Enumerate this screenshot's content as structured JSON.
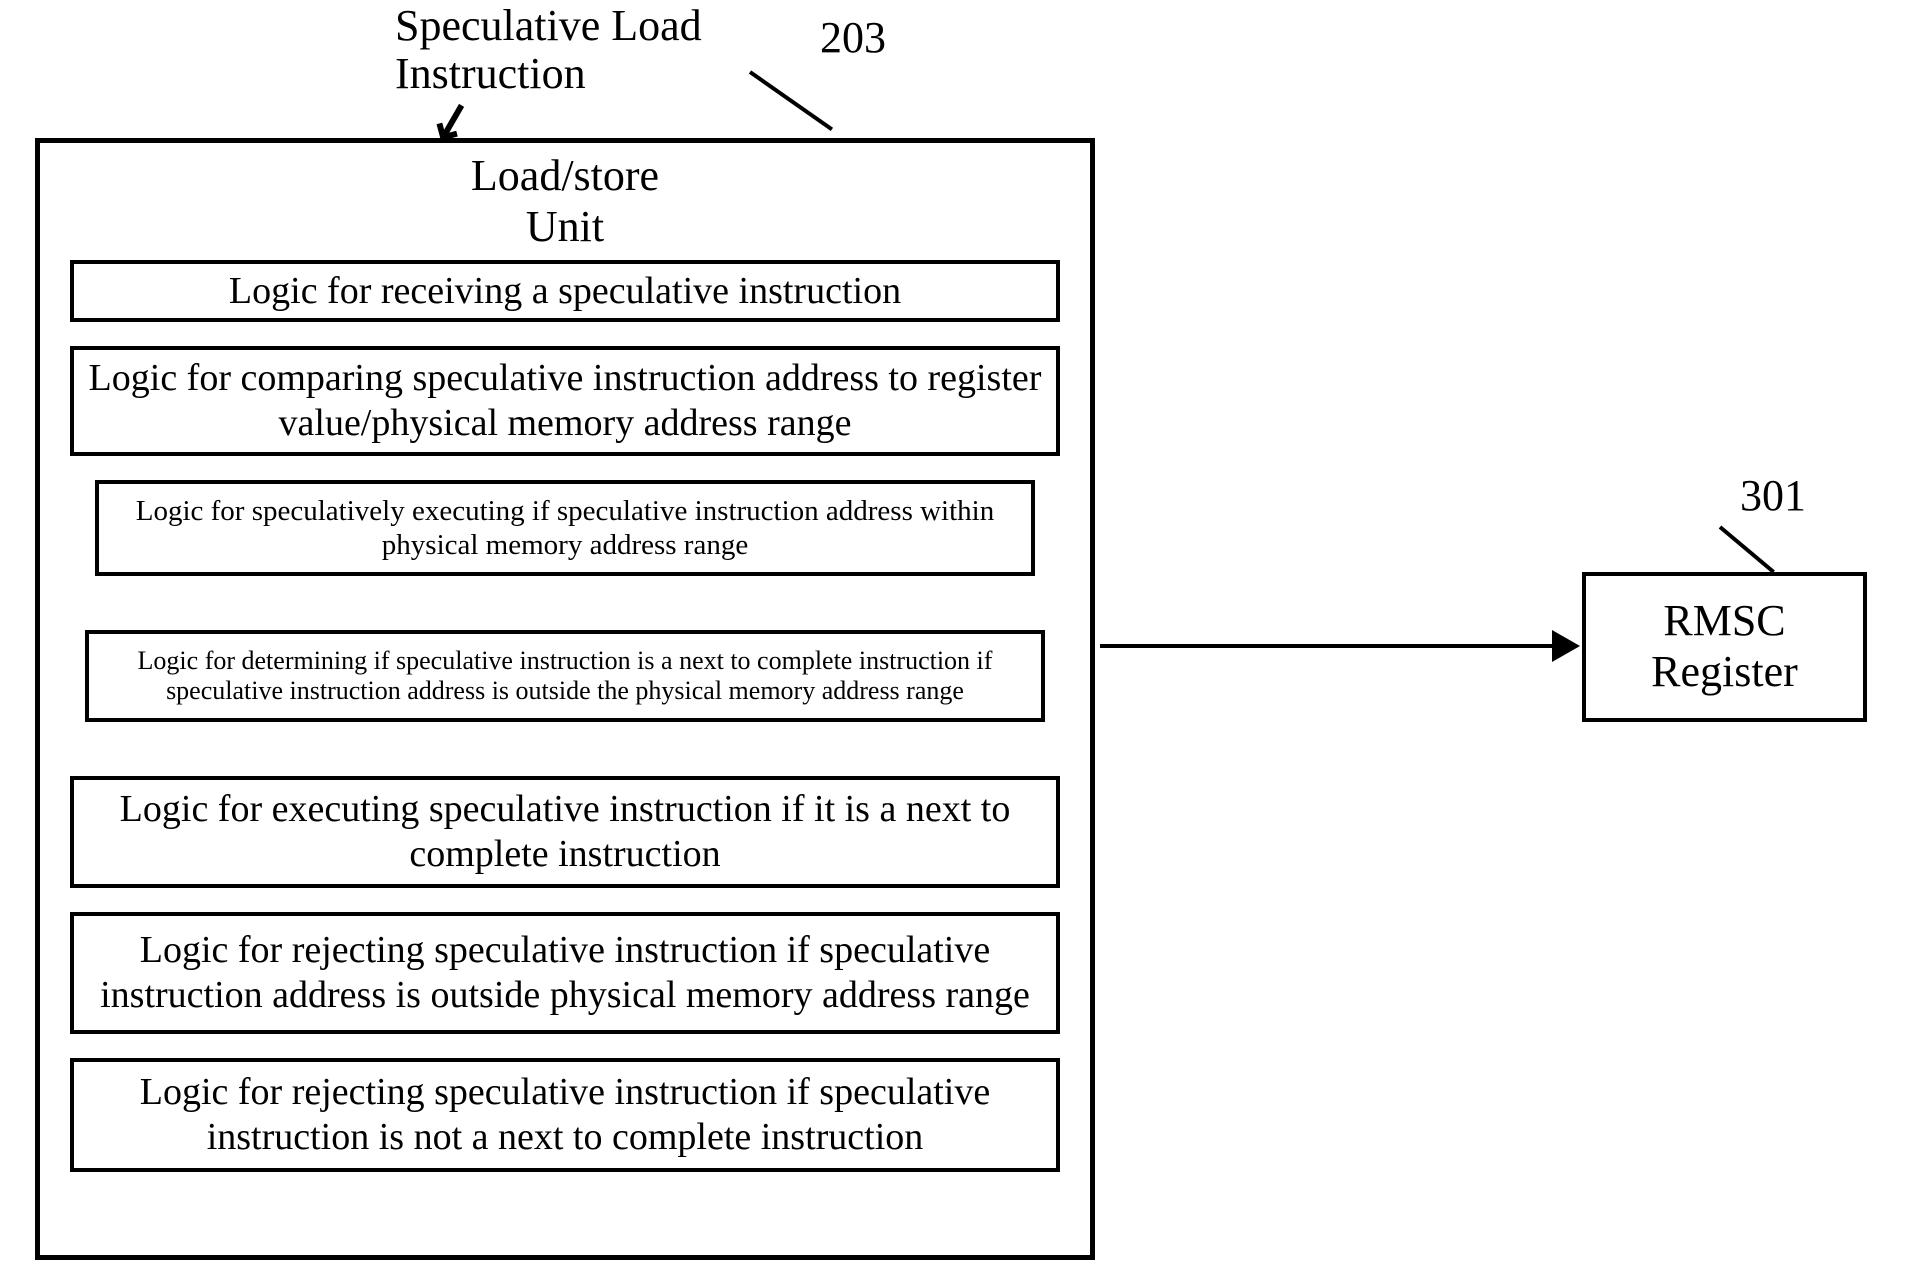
{
  "input": {
    "label": "Speculative Load\nInstruction"
  },
  "refs": {
    "main": "203",
    "register": "301"
  },
  "main_unit": {
    "title": "Load/store\nUnit",
    "logic": [
      "Logic for receiving a speculative instruction",
      "Logic for comparing speculative instruction address to register value/physical memory address range",
      "Logic for speculatively executing if speculative instruction address within physical memory address range",
      "Logic for determining if speculative instruction is a next to complete instruction if speculative instruction address is outside the physical memory address range",
      "Logic for executing speculative instruction if it is a next to complete instruction",
      "Logic for rejecting speculative instruction if speculative instruction address is outside physical memory address range",
      "Logic for rejecting speculative instruction if speculative instruction is not a next to complete instruction"
    ]
  },
  "register": {
    "label": "RMSC\nRegister"
  }
}
